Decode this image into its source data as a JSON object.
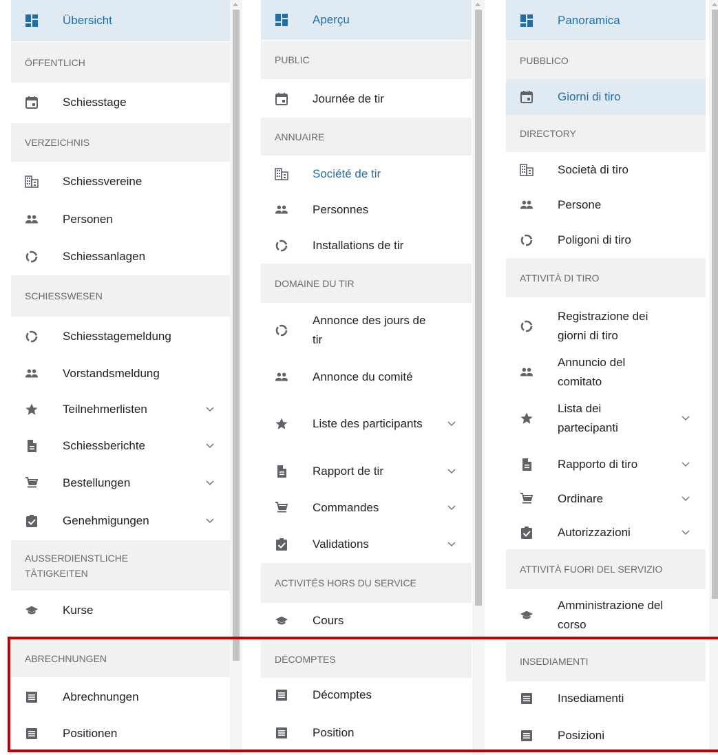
{
  "panels": [
    {
      "sections": [
        {
          "type": "item",
          "label": "Übersicht",
          "icon": "dashboard-icon",
          "state": "active"
        },
        {
          "type": "section",
          "label": "ÖFFENTLICH"
        },
        {
          "type": "item",
          "label": "Schiesstage",
          "icon": "calendar-icon"
        },
        {
          "type": "section",
          "label": "VERZEICHNIS"
        },
        {
          "type": "item",
          "label": "Schiessvereine",
          "icon": "building-icon"
        },
        {
          "type": "item",
          "label": "Personen",
          "icon": "people-icon"
        },
        {
          "type": "item",
          "label": "Schiessanlagen",
          "icon": "ring-icon"
        },
        {
          "type": "section",
          "label": "SCHIESSWESEN"
        },
        {
          "type": "item",
          "label": "Schiesstagemeldung",
          "icon": "ring-icon"
        },
        {
          "type": "item",
          "label": "Vorstandsmeldung",
          "icon": "people-icon"
        },
        {
          "type": "item",
          "label": "Teilnehmerlisten",
          "icon": "star-icon",
          "chevron": true
        },
        {
          "type": "item",
          "label": "Schiessberichte",
          "icon": "document-icon",
          "chevron": true
        },
        {
          "type": "item",
          "label": "Bestellungen",
          "icon": "cart-icon",
          "chevron": true
        },
        {
          "type": "item",
          "label": "Genehmigungen",
          "icon": "clipboard-check-icon",
          "chevron": true
        },
        {
          "type": "section",
          "label": "AUSSERDIENSTLICHE TÄTIGKEITEN"
        },
        {
          "type": "item",
          "label": "Kurse",
          "icon": "graduation-cap-icon"
        },
        {
          "type": "section",
          "label": "ABRECHNUNGEN"
        },
        {
          "type": "item",
          "label": "Abrechnungen",
          "icon": "list-icon"
        },
        {
          "type": "item",
          "label": "Positionen",
          "icon": "list-icon"
        }
      ]
    },
    {
      "sections": [
        {
          "type": "item",
          "label": "Aperçu",
          "icon": "dashboard-icon",
          "state": "active"
        },
        {
          "type": "section",
          "label": "PUBLIC"
        },
        {
          "type": "item",
          "label": "Journée de tir",
          "icon": "calendar-icon"
        },
        {
          "type": "section",
          "label": "ANNUAIRE"
        },
        {
          "type": "item",
          "label": "Société de tir",
          "icon": "building-icon",
          "state": "selected"
        },
        {
          "type": "item",
          "label": "Personnes",
          "icon": "people-icon"
        },
        {
          "type": "item",
          "label": "Installations de tir",
          "icon": "ring-icon"
        },
        {
          "type": "section",
          "label": "DOMAINE DU TIR"
        },
        {
          "type": "item",
          "label": "Annonce des jours de tir",
          "icon": "ring-icon"
        },
        {
          "type": "item",
          "label": "Annonce du comité",
          "icon": "people-icon"
        },
        {
          "type": "item",
          "label": "Liste des participants",
          "icon": "star-icon",
          "chevron": true
        },
        {
          "type": "item",
          "label": "Rapport de tir",
          "icon": "document-icon",
          "chevron": true
        },
        {
          "type": "item",
          "label": "Commandes",
          "icon": "cart-icon",
          "chevron": true
        },
        {
          "type": "item",
          "label": "Validations",
          "icon": "clipboard-check-icon",
          "chevron": true
        },
        {
          "type": "section",
          "label": "ACTIVITÉS HORS DU SERVICE"
        },
        {
          "type": "item",
          "label": "Cours",
          "icon": "graduation-cap-icon"
        },
        {
          "type": "section",
          "label": "DÉCOMPTES"
        },
        {
          "type": "item",
          "label": "Décomptes",
          "icon": "list-icon"
        },
        {
          "type": "item",
          "label": "Position",
          "icon": "list-icon"
        }
      ]
    },
    {
      "sections": [
        {
          "type": "item",
          "label": "Panoramica",
          "icon": "dashboard-icon",
          "state": "active"
        },
        {
          "type": "section",
          "label": "PUBBLICO"
        },
        {
          "type": "item",
          "label": "Giorni di tiro",
          "icon": "calendar-icon",
          "state": "active"
        },
        {
          "type": "section",
          "label": "DIRECTORY"
        },
        {
          "type": "item",
          "label": "Società di tiro",
          "icon": "building-icon"
        },
        {
          "type": "item",
          "label": "Persone",
          "icon": "people-icon"
        },
        {
          "type": "item",
          "label": "Poligoni di tiro",
          "icon": "ring-icon"
        },
        {
          "type": "section",
          "label": "ATTIVITÀ DI TIRO"
        },
        {
          "type": "item",
          "label": "Registrazione dei giorni di tiro",
          "icon": "ring-icon"
        },
        {
          "type": "item",
          "label": "Annuncio del comitato",
          "icon": "people-icon"
        },
        {
          "type": "item",
          "label": "Lista dei partecipanti",
          "icon": "star-icon",
          "chevron": true
        },
        {
          "type": "item",
          "label": "Rapporto di tiro",
          "icon": "document-icon",
          "chevron": true
        },
        {
          "type": "item",
          "label": "Ordinare",
          "icon": "cart-icon",
          "chevron": true
        },
        {
          "type": "item",
          "label": "Autorizzazioni",
          "icon": "clipboard-check-icon",
          "chevron": true
        },
        {
          "type": "section",
          "label": "ATTIVITÀ FUORI DEL SERVIZIO"
        },
        {
          "type": "item",
          "label": "Amministrazione del corso",
          "icon": "graduation-cap-icon"
        },
        {
          "type": "section",
          "label": "INSEDIAMENTI"
        },
        {
          "type": "item",
          "label": "Insediamenti",
          "icon": "list-icon"
        },
        {
          "type": "item",
          "label": "Posizioni",
          "icon": "list-icon"
        }
      ]
    }
  ],
  "colors": {
    "active_bg": "#dfeaf2",
    "active_text": "#1f6fa8",
    "section_bg": "#f1f1f1",
    "icon": "#5f6368",
    "highlight_border": "#c00000"
  }
}
